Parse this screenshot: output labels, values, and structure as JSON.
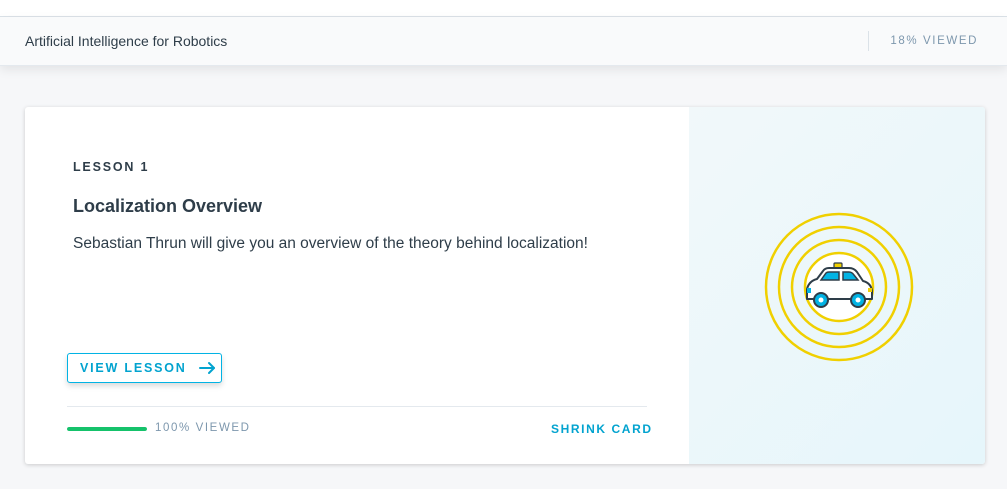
{
  "header": {
    "course_title": "Artificial Intelligence for Robotics",
    "viewed_label": "18% VIEWED"
  },
  "lesson": {
    "number_label": "LESSON 1",
    "title": "Localization Overview",
    "description": "Sebastian Thrun will give you an overview of the theory behind localization!",
    "view_button_label": "VIEW LESSON",
    "progress_fraction": 1.0,
    "progress_label": "100% VIEWED",
    "shrink_label": "SHRINK CARD",
    "illustration_icon": "self-driving-car-icon"
  },
  "colors": {
    "accent": "#02b3e4",
    "progress": "#15c26b",
    "rings": "#f0d000",
    "text": "#2e3d49",
    "muted": "#7d97ad"
  }
}
